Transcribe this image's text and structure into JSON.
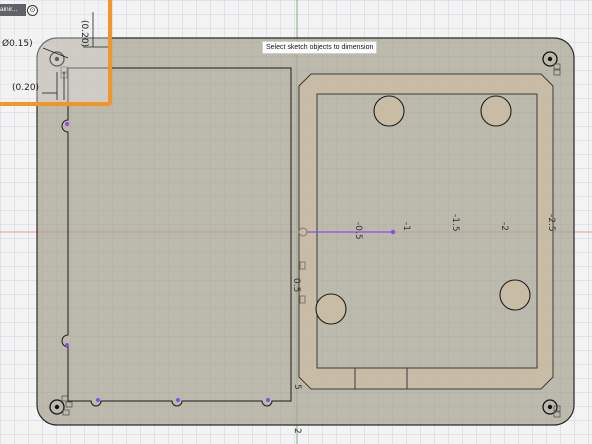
{
  "status_hint": "Select sketch objects to dimension",
  "overlay": {
    "constraint_label": "ainir...",
    "dims": {
      "vertical": "(0.20)",
      "diameter": "Ø0.15)",
      "horizontal": "(0.20)"
    }
  },
  "axis_ticks": [
    "-0.5",
    "-1",
    "-1.5",
    "-2",
    "-2.5"
  ],
  "edge_labels": {
    "bottom_tick": "2",
    "side_tick_a": "0.5",
    "side_tick_b": "5"
  },
  "colors": {
    "plate": "#a9a596",
    "frame": "#c9bca5",
    "accent": "#f0962c",
    "x_axis": "#e07a6a",
    "y_axis": "#5ea35e",
    "selection": "#8a4de8"
  }
}
